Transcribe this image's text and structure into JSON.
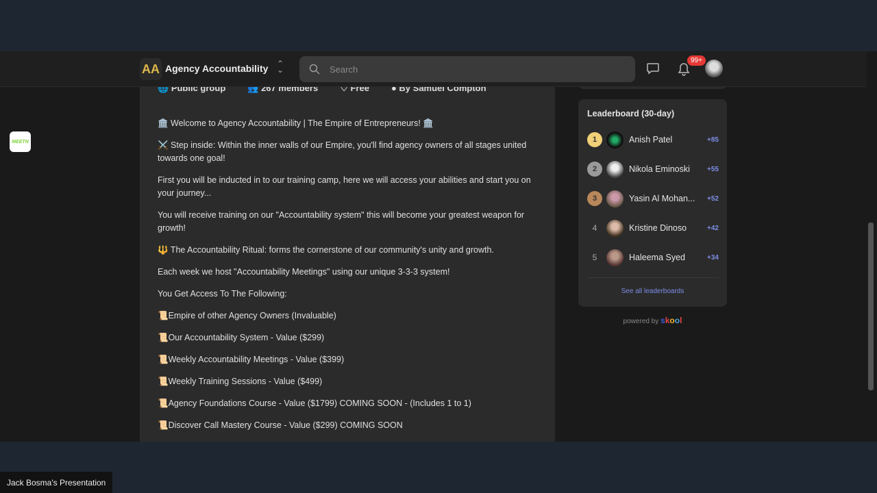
{
  "header": {
    "logo_text": "AA",
    "group_name": "Agency Accountability",
    "search_placeholder": "Search",
    "notifications": "99+"
  },
  "meta": {
    "privacy": "Public group",
    "members": "267 members",
    "price": "Free",
    "owner": "By Samuel Compton"
  },
  "description": [
    "🏛️ Welcome to Agency Accountability | The Empire of Entrepreneurs! 🏛️",
    "⚔️ Step inside: Within the inner walls of our Empire, you'll find agency owners of all stages united towards one goal!",
    "First you will be inducted in to our training camp, here we will access your abilities and start you on your journey...",
    "You will receive training on our \"Accountability system\" this will become your greatest weapon for growth!",
    "🔱 The Accountability Ritual: forms the cornerstone of our community's unity and growth.",
    "Each week we host \"Accountability Meetings\" using our unique 3-3-3 system!",
    "You Get Access To The Following:",
    "📜Empire of other Agency Owners (Invaluable)",
    "📜Our Accountability System - Value ($299)",
    "📜Weekly Accountability Meetings - Value ($399)",
    "📜Weekly Training Sessions - Value ($499)",
    "📜Agency Foundations Course - Value ($1799) COMING SOON - (Includes 1 to 1)",
    "📜Discover Call Mastery Course - Value ($299) COMING SOON"
  ],
  "leaderboard": {
    "title": "Leaderboard (30-day)",
    "see_all": "See all leaderboards",
    "entries": [
      {
        "rank": "1",
        "name": "Anish Patel",
        "points": "+85"
      },
      {
        "rank": "2",
        "name": "Nikola Eminoski",
        "points": "+55"
      },
      {
        "rank": "3",
        "name": "Yasin Al Mohan...",
        "points": "+52"
      },
      {
        "rank": "4",
        "name": "Kristine Dinoso",
        "points": "+42"
      },
      {
        "rank": "5",
        "name": "Haleema Syed",
        "points": "+34"
      }
    ]
  },
  "powered": {
    "prefix": "powered by",
    "brand": "skool"
  },
  "side_app": {
    "label": "MEETN"
  },
  "presentation_caption": "Jack Bosma's Presentation",
  "colors": {
    "accent": "#7d8ee8",
    "badge": "#e53935",
    "gold": "#f0d078",
    "silver": "#9a9a9a",
    "bronze": "#b8875a"
  }
}
